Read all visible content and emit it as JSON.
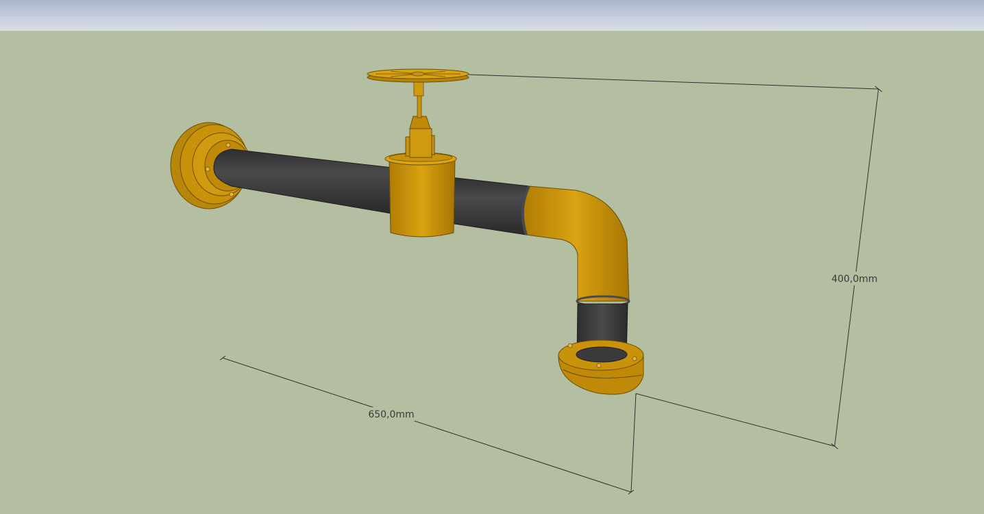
{
  "viewport": {
    "sky_color": "#c5cedb",
    "ground_color": "#b3bfa0"
  },
  "model": {
    "component": "pipe-with-valve",
    "body_color": "#c8920a",
    "pipe_color": "#3d3d3f"
  },
  "dimensions": {
    "width_label": "650,0mm",
    "height_label": "400,0mm"
  }
}
